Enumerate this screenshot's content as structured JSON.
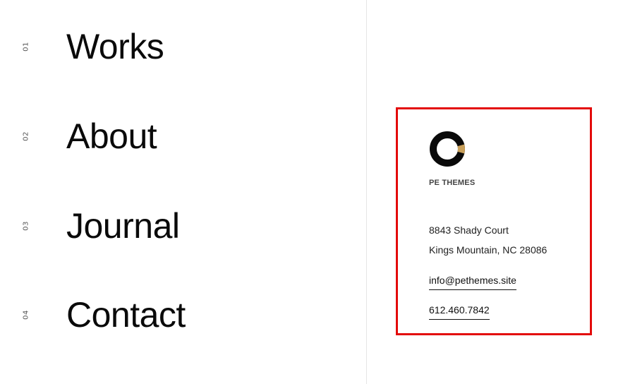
{
  "menu": {
    "items": [
      {
        "number": "01",
        "label": "Works"
      },
      {
        "number": "02",
        "label": "About"
      },
      {
        "number": "03",
        "label": "Journal"
      },
      {
        "number": "04",
        "label": "Contact"
      }
    ]
  },
  "contact_card": {
    "logo_icon": "ring-logo-icon",
    "brand_name": "PE THEMES",
    "address_line1": "8843 Shady Court",
    "address_line2": "Kings Mountain, NC 28086",
    "email": "info@pethemes.site",
    "phone": "612.460.7842"
  },
  "colors": {
    "highlight_border": "#e30b0b",
    "logo_primary": "#0a0a0a",
    "logo_accent": "#c9a05a",
    "divider": "#e6e6e6"
  }
}
